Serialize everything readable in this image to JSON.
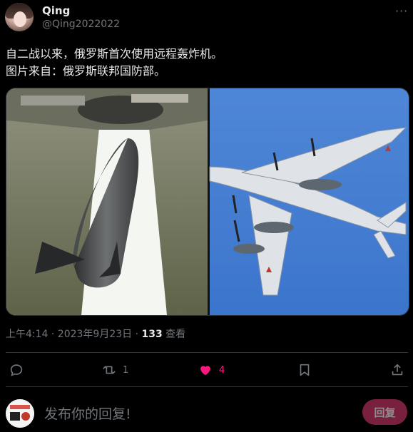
{
  "author": {
    "name": "Qing",
    "handle": "@Qing2022022"
  },
  "menu": {
    "more_label": "···"
  },
  "tweet": {
    "text": "自二战以来，俄罗斯首次使用远程轰炸机。\n图片来自：俄罗斯联邦国防部。"
  },
  "meta": {
    "time": "上午4:14 · 2023年9月23日 · ",
    "views_count": "133",
    "views_label": " 查看"
  },
  "actions": {
    "reply_count": "",
    "retweet_count": "1",
    "like_count": "4",
    "like_color": "#f91880"
  },
  "composer": {
    "placeholder": "发布你的回复!",
    "reply_button": "回复"
  },
  "colors": {
    "accent": "#f91880",
    "muted": "#71767b",
    "reply_button_bg": "#79203f"
  }
}
